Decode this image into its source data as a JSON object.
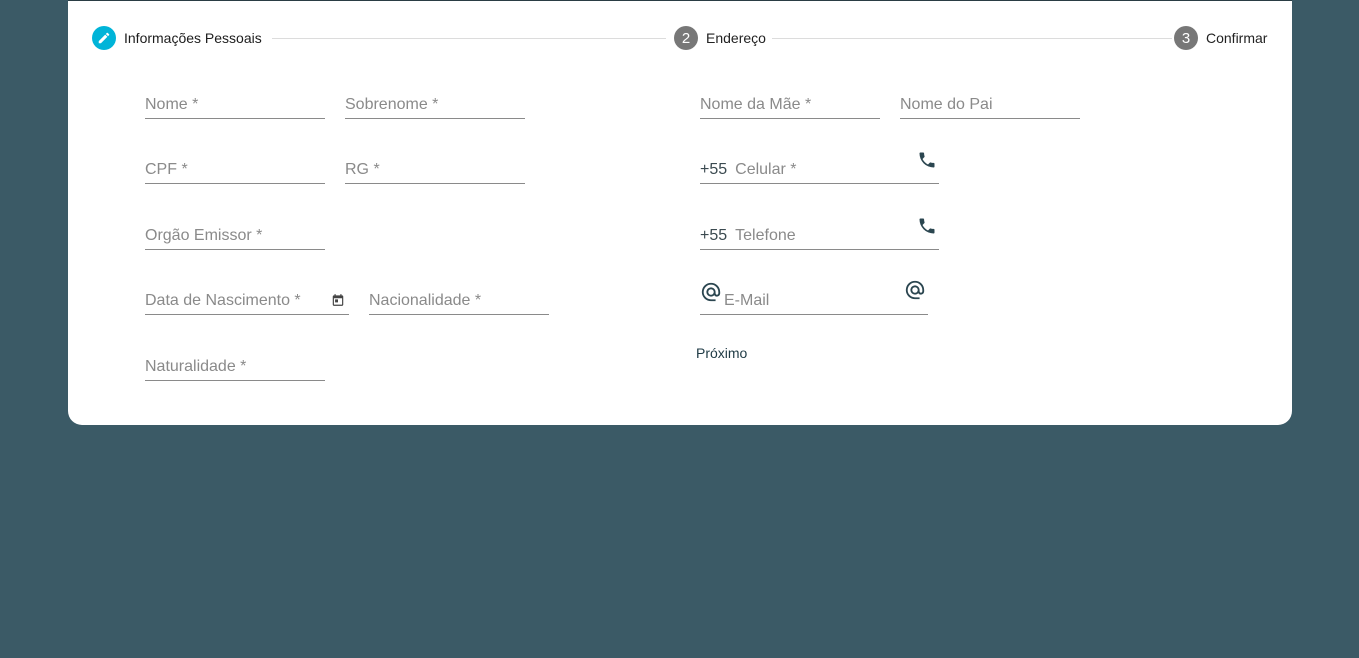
{
  "stepper": {
    "steps": [
      {
        "label": "Informações Pessoais"
      },
      {
        "number": "2",
        "label": "Endereço"
      },
      {
        "number": "3",
        "label": "Confirmar"
      }
    ]
  },
  "form": {
    "nome": "Nome *",
    "sobrenome": "Sobrenome *",
    "cpf": "CPF *",
    "rg": "RG *",
    "orgao_emissor": "Orgão Emissor *",
    "data_nascimento": "Data de Nascimento *",
    "nacionalidade": "Nacionalidade *",
    "naturalidade": "Naturalidade *",
    "nome_mae": "Nome da Mãe *",
    "nome_pai": "Nome do Pai",
    "celular_prefix": "+55",
    "celular": "Celular *",
    "telefone_prefix": "+55",
    "telefone": "Telefone",
    "email": "E-Mail"
  },
  "actions": {
    "next_label": "Próximo"
  },
  "colors": {
    "background": "#3b5a66",
    "accent": "#00b4d8",
    "step_inactive": "#777777"
  }
}
